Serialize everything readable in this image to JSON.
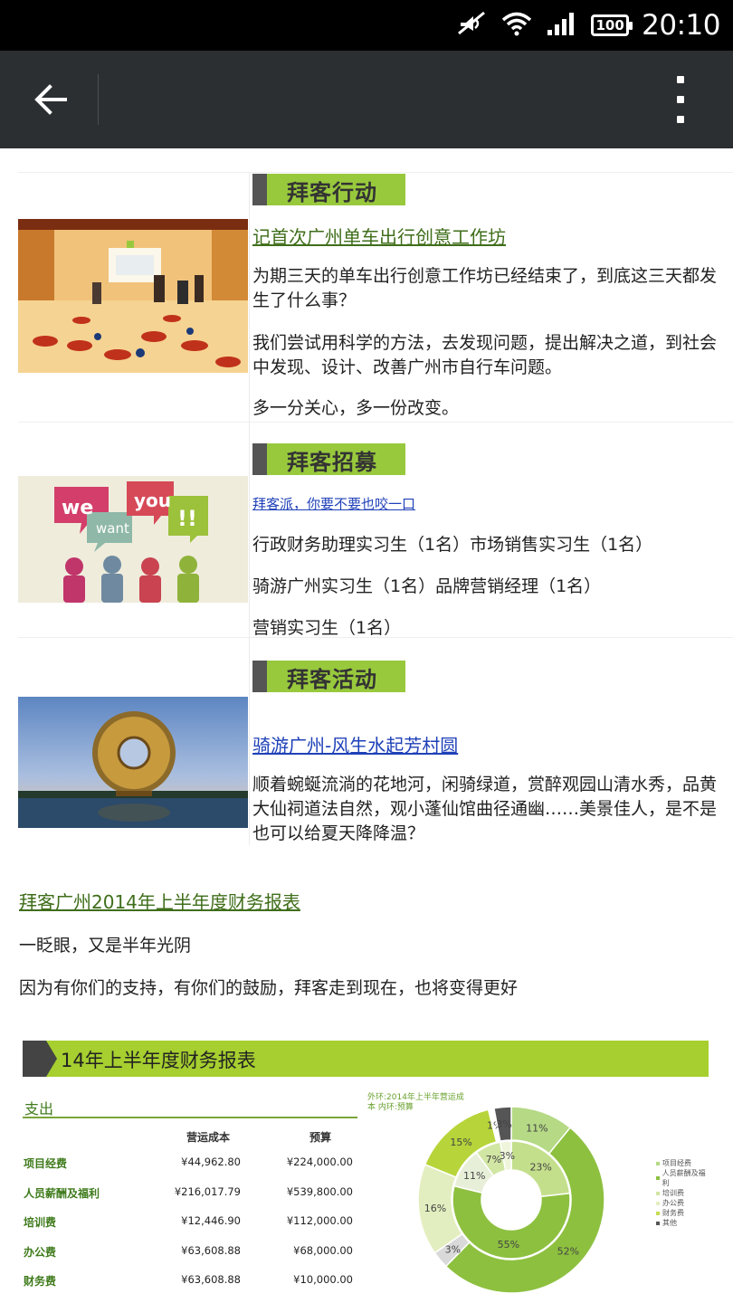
{
  "status_bar": {
    "time": "20:10",
    "battery": "100"
  },
  "app_bar": {
    "back_icon": "arrow-left-icon",
    "menu_icon": "more-vertical-icon"
  },
  "sections": [
    {
      "banner": "拜客行动",
      "title": "记首次广州单车出行创意工作坊",
      "paragraphs": [
        "为期三天的单车出行创意工作坊已经结束了，到底这三天都发生了什么事？",
        "我们尝试用科学的方法，去发现问题，提出解决之道，到社会中发现、设计、改善广州市自行车问题。",
        "多一分关心，多一份改变。"
      ]
    },
    {
      "banner": "拜客招募",
      "title": "拜客派，你要不要也咬一口",
      "paragraphs": [
        "行政财务助理实习生（1名）市场销售实习生（1名）",
        "骑游广州实习生（1名）品牌营销经理（1名）",
        "营销实习生（1名）"
      ],
      "image_text": {
        "we": "we",
        "want": "want",
        "you": "you",
        "bang": "!!"
      }
    },
    {
      "banner": "拜客活动",
      "title": "骑游广州-风生水起芳村圆",
      "paragraphs": [
        "顺着蜿蜒流淌的花地河，闲骑绿道，赏醉观园山清水秀，品黄大仙祠道法自然，观小蓬仙馆曲径通幽……美景佳人，是不是也可以给夏天降降温？"
      ]
    }
  ],
  "finance": {
    "link": "拜客广州2014年上半年度财务报表",
    "lines": [
      "一眨眼，又是半年光阴",
      "因为有你们的支持，有你们的鼓励，拜客走到现在，也将变得更好"
    ]
  },
  "report": {
    "header": "14年上半年度财务报表",
    "expense_title": "支出",
    "columns": [
      "营运成本",
      "预算"
    ],
    "rows": [
      {
        "label": "项目经费",
        "cost": "¥44,962.80",
        "budget": "¥224,000.00"
      },
      {
        "label": "人员薪酬及福利",
        "cost": "¥216,017.79",
        "budget": "¥539,800.00"
      },
      {
        "label": "培训费",
        "cost": "¥12,446.90",
        "budget": "¥112,000.00"
      },
      {
        "label": "办公费",
        "cost": "¥63,608.88",
        "budget": "¥68,000.00"
      },
      {
        "label": "财务费",
        "cost": "¥63,608.88",
        "budget": "¥10,000.00"
      }
    ],
    "pie_caption": "外环:2014年上半年营运成本 内环:预算"
  },
  "chart_data": {
    "type": "pie",
    "title": "外环:2014年上半年营运成本 内环:预算",
    "categories": [
      "项目经费",
      "人员薪酬及福利",
      "培训费",
      "办公费",
      "财务费",
      "其他"
    ],
    "series": [
      {
        "name": "外环",
        "values": [
          11,
          52,
          3,
          16,
          15,
          1,
          3
        ]
      },
      {
        "name": "内环",
        "values": [
          23,
          55,
          11,
          7,
          3
        ]
      }
    ],
    "labels_outer": [
      "11%",
      "52%",
      "3%",
      "16%",
      "15%",
      "1%",
      "3%"
    ],
    "labels_inner": [
      "23%",
      "55%",
      "11%",
      "7%",
      "3%"
    ],
    "legend": [
      "项目经费",
      "人员薪酬及福利",
      "培训费",
      "办公费",
      "财务费",
      "其他"
    ],
    "legend_placement": "right",
    "colors": [
      "#b5d985",
      "#8dc03f",
      "#d2e6a4",
      "#e3eec0",
      "#c4dd53",
      "#555555"
    ]
  }
}
